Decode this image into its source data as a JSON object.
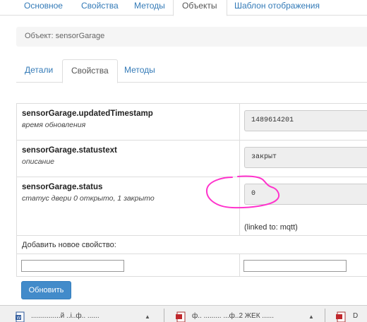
{
  "top_tabs": [
    {
      "label": "Основное",
      "active": false
    },
    {
      "label": "Свойства",
      "active": false
    },
    {
      "label": "Методы",
      "active": false
    },
    {
      "label": "Объекты",
      "active": true
    },
    {
      "label": "Шаблон отображения",
      "active": false
    }
  ],
  "object_bar": {
    "label": "Объект: sensorGarage"
  },
  "sub_tabs": [
    {
      "label": "Детали",
      "active": false
    },
    {
      "label": "Свойства",
      "active": true
    },
    {
      "label": "Методы",
      "active": false
    }
  ],
  "properties": [
    {
      "name": "sensorGarage.updatedTimestamp",
      "description": "время обновления",
      "value": "1489614201"
    },
    {
      "name": "sensorGarage.statustext",
      "description": "описание",
      "value": "закрыт"
    },
    {
      "name": "sensorGarage.status",
      "description": "статус двери 0 открыто, 1 закрыто",
      "value": "0",
      "linked": "(linked to: mqtt)"
    }
  ],
  "add_property": {
    "label": "Добавить новое свойство:",
    "name_value": "",
    "value_value": ""
  },
  "update_button": {
    "label": "Обновить"
  },
  "taskbar": {
    "items": [
      {
        "icon": "word-doc-icon",
        "text": "...............й ..і..ф.. ......"
      },
      {
        "icon": "pdf-icon",
        "text": "ф.. ......... ...ф..2 ЖЕК ......"
      },
      {
        "icon": "pdf-icon",
        "text": "D"
      }
    ]
  },
  "colors": {
    "link": "#337ab7",
    "button": "#428bca",
    "annotation": "#ff33cc"
  }
}
